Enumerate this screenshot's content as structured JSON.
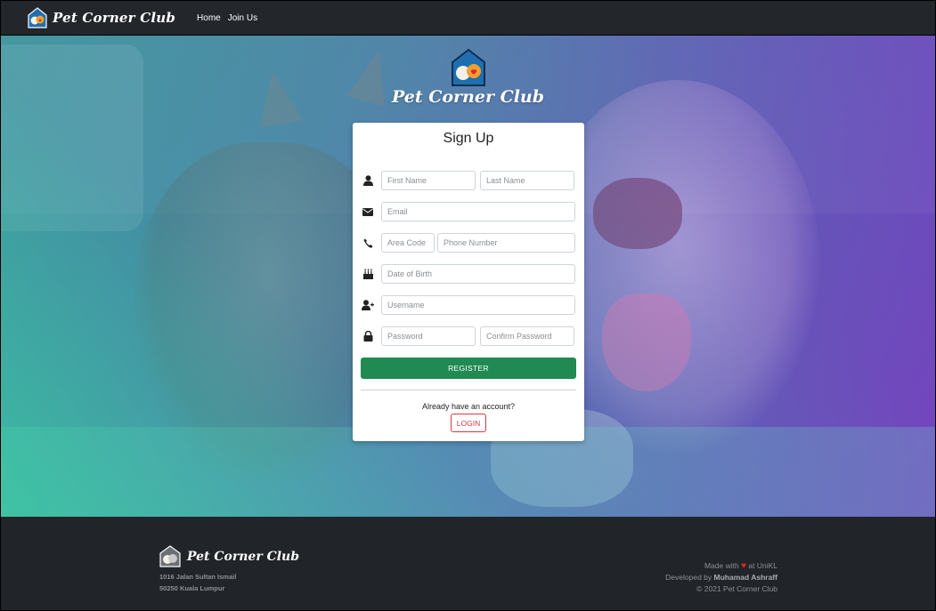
{
  "navbar": {
    "brand": "Pet Corner Club",
    "links": [
      "Home",
      "Join Us"
    ]
  },
  "hero": {
    "title": "Pet Corner Club"
  },
  "signup": {
    "title": "Sign Up",
    "first_name_placeholder": "First Name",
    "last_name_placeholder": "Last Name",
    "email_placeholder": "Email",
    "area_code_placeholder": "Area Code",
    "phone_placeholder": "Phone Number",
    "dob_placeholder": "Date of Birth",
    "username_placeholder": "Username",
    "password_placeholder": "Password",
    "confirm_password_placeholder": "Confirm Password",
    "register_label": "REGISTER",
    "already_text": "Already have an account?",
    "login_label": "LOGIN"
  },
  "footer": {
    "brand": "Pet Corner Club",
    "address_line1": "1016 Jalan Sultan Ismail",
    "address_line2": "50250 Kuala Lumpur",
    "made_with_prefix": "Made with",
    "made_with_suffix": "at UniKL",
    "developed_by_prefix": "Developed by",
    "developer": "Muhamad Ashraff",
    "copyright": "© 2021 Pet Corner Club"
  },
  "colors": {
    "navbar_bg": "#23272b",
    "register_green": "#218a52",
    "login_red": "#dc3545",
    "heart_red": "#e3242b"
  },
  "icons": [
    "logo-icon",
    "user-icon",
    "envelope-icon",
    "phone-icon",
    "birthday-cake-icon",
    "user-plus-icon",
    "lock-icon",
    "heart-icon"
  ]
}
